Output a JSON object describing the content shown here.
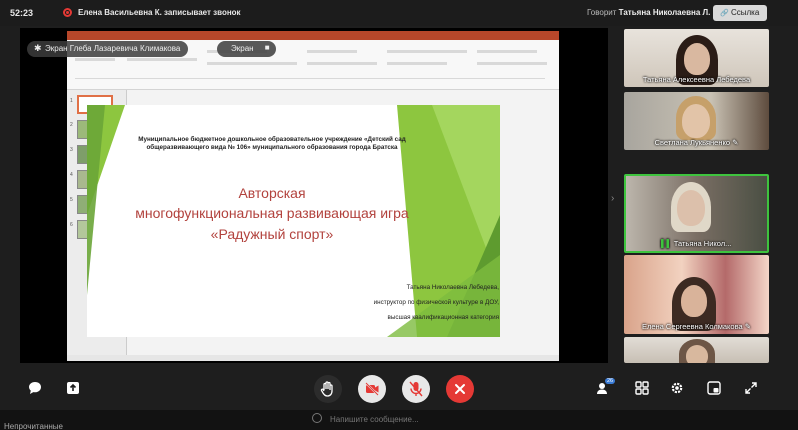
{
  "topbar": {
    "timer": "52:23",
    "recording_text": "Елена Васильевна К. записывает звонок",
    "speaker_prefix": "Говорит",
    "speaker_name": "Татьяна Николаевна Л.",
    "link_button": "Ссылка"
  },
  "screen_share": {
    "owner_label": "Экран Глеба Лазаревича Климакова",
    "screen_pill": "Экран",
    "slide": {
      "institution": "Муниципальное бюджетное дошкольное образовательное учреждение «Детский сад общеразвивающего вида № 106» муниципального образования города Братска",
      "title_line1": "Авторская",
      "title_line2": "многофункциональная развивающая игра",
      "title_line3": "«Радужный спорт»",
      "author_line1": "Татьяна Николаевна Лебедева,",
      "author_line2": "инструктор по физической культуре в ДОУ,",
      "author_line3": "высшая квалификационная категория"
    },
    "thumbnail_numbers": [
      "1",
      "2",
      "3",
      "4",
      "5",
      "6"
    ]
  },
  "participants": [
    {
      "name": "Татьяна Алексеевна Лебедева"
    },
    {
      "name": "Светлана Лукьяненко"
    },
    {
      "name": "Татьяна Никол..."
    },
    {
      "name": "Елена Сергеевна Колмакова"
    },
    {
      "name": ""
    }
  ],
  "controls": {
    "chat_icon": "chat-icon",
    "share_icon": "share-screen-icon",
    "hand_icon": "raise-hand-icon",
    "camera_icon": "camera-off-icon",
    "mic_icon": "mic-off-icon",
    "hangup_icon": "hang-up-icon",
    "participants_icon": "participants-icon",
    "participants_count": "26",
    "grid_icon": "grid-view-icon",
    "settings_icon": "gear-icon",
    "pip_icon": "picture-in-picture-icon",
    "fullscreen_icon": "fullscreen-icon"
  },
  "chat": {
    "unread": "Непрочитанные",
    "placeholder": "Напишите сообщение..."
  },
  "colors": {
    "accent_red": "#e53935",
    "active_speaker": "#3ec43e",
    "slide_title": "#b2423d",
    "slide_green": "#8dc63f"
  }
}
